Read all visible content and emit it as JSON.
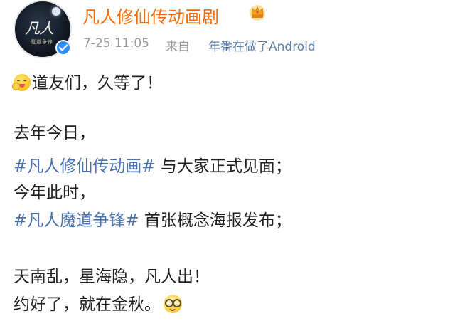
{
  "post": {
    "author": "凡人修仙传动画剧",
    "timestamp": "7-25 11:05",
    "source_label": "来自",
    "source": "年番在做了Android",
    "verified": true,
    "avatar_title": "凡人",
    "avatar_subtitle": "魔道争锋"
  },
  "icons": {
    "crown": "crown-vip-icon",
    "verified": "verified-check-icon",
    "emoji_start": "face-hand-over-mouth-emoji",
    "emoji_end": "face-with-glasses-emoji"
  },
  "body": {
    "line1": "道友们，久等了！",
    "line2": "去年今日，",
    "line3_tag": "#凡人修仙传动画#",
    "line3_text": " 与大家正式见面；",
    "line4": "今年此时，",
    "line5_tag": "#凡人魔道争锋#",
    "line5_text": " 首张概念海报发布；",
    "line6": "天南乱，星海隐，凡人出！",
    "line7": "约好了，就在金秋。"
  },
  "colors": {
    "author": "#f26b08",
    "hashtag": "#4a70ad",
    "meta": "#999999",
    "source": "#5b7ea9",
    "verified": "#2f8ef5"
  }
}
